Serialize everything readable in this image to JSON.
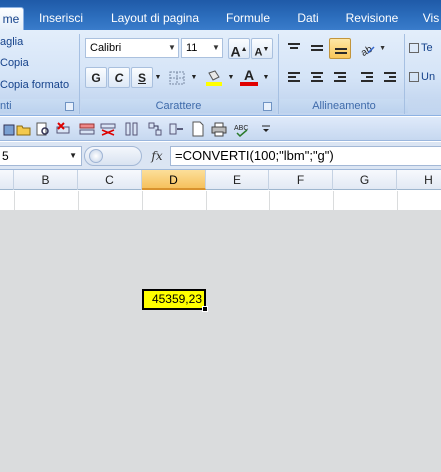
{
  "tabs": [
    {
      "label": "me",
      "active": true
    },
    {
      "label": "Inserisci",
      "active": false
    },
    {
      "label": "Layout di pagina",
      "active": false
    },
    {
      "label": "Formule",
      "active": false
    },
    {
      "label": "Dati",
      "active": false
    },
    {
      "label": "Revisione",
      "active": false
    },
    {
      "label": "Vis",
      "active": false
    }
  ],
  "clipboard": {
    "cut": "aglia",
    "copy": "Copia",
    "format_painter": "Copia formato",
    "group_label": "nti"
  },
  "font": {
    "name": "Calibri",
    "size": "11",
    "bold": "G",
    "italic": "C",
    "underline": "S",
    "grow": "A",
    "shrink": "A",
    "font_color_letter": "A",
    "group_label": "Carattere",
    "highlight_color": "#ffff00",
    "font_color": "#e00000"
  },
  "alignment": {
    "group_label": "Allineamento",
    "wrap_label": "Te",
    "merge_label": "Un"
  },
  "formula_bar": {
    "name_box": "5",
    "fx": "fx",
    "formula": "=CONVERTI(100;\"lbm\";\"g\")"
  },
  "columns": [
    "B",
    "C",
    "D",
    "E",
    "F",
    "G",
    "H"
  ],
  "selected_column": "D",
  "active_cell_value": "45359,23",
  "colors": {
    "ribbon_tab_bar": "#2d6fbe",
    "active_cell_fill": "#ffff00",
    "selected_header": "#f6c15d"
  }
}
